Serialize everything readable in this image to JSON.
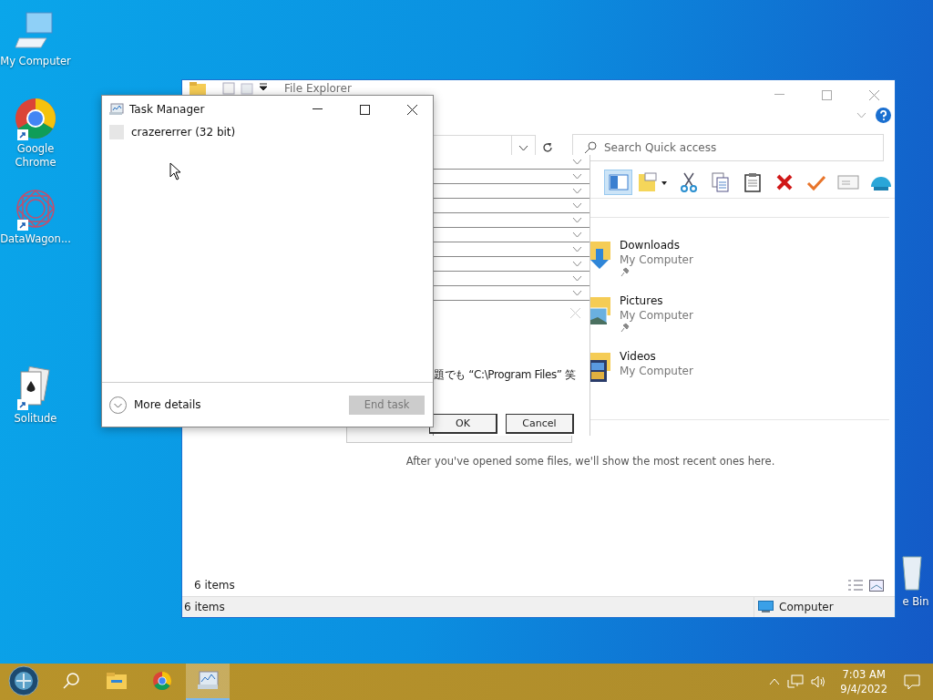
{
  "desktop_icons": [
    {
      "label": "My Computer",
      "kind": "computer",
      "shortcut": false
    },
    {
      "label": "Google Chrome",
      "kind": "chrome",
      "shortcut": true
    },
    {
      "label": "DataWagon...",
      "kind": "datawagon",
      "shortcut": true
    },
    {
      "label": "Solitude",
      "kind": "cards",
      "shortcut": true
    },
    {
      "label": "e Bin",
      "kind": "bin",
      "shortcut": false
    }
  ],
  "file_explorer": {
    "title": "File Explorer",
    "search": {
      "placeholder": "Search Quick access"
    },
    "toolbar": [
      {
        "kind": "pane",
        "selected": true
      },
      {
        "kind": "note",
        "selected": false
      },
      {
        "kind": "cut",
        "selected": false
      },
      {
        "kind": "copy",
        "selected": false
      },
      {
        "kind": "paste",
        "selected": false
      },
      {
        "kind": "delete",
        "selected": false
      },
      {
        "kind": "check",
        "selected": false
      },
      {
        "kind": "mail",
        "selected": false
      },
      {
        "kind": "shell",
        "selected": false
      }
    ],
    "items": [
      {
        "name": "Downloads",
        "location": "My Computer",
        "kind": "downloads",
        "pinned": true
      },
      {
        "name": "Pictures",
        "location": "My Computer",
        "kind": "pictures",
        "pinned": true
      },
      {
        "name": "Videos",
        "location": "My Computer",
        "kind": "videos",
        "pinned": false
      }
    ],
    "recent_message": "After you've opened some files, we'll show the most recent ones here.",
    "item_count": "6 items",
    "status_bar": {
      "items": "6 items",
      "location": "Computer"
    }
  },
  "broken_dialog": {
    "message": "題でも “C:\\Program Files” 笑",
    "buttons": [
      "OK",
      "Cancel"
    ]
  },
  "task_manager": {
    "title": "Task Manager",
    "apps": [
      {
        "name": "crazererrer (32 bit)"
      }
    ],
    "more_details": "More details",
    "end_task": {
      "label": "End task",
      "disabled": true
    }
  },
  "taskbar": {
    "apps": [
      {
        "kind": "start",
        "selected": false
      },
      {
        "kind": "search",
        "selected": false
      },
      {
        "kind": "explorer",
        "selected": false
      },
      {
        "kind": "chrome",
        "selected": false
      },
      {
        "kind": "taskmgr",
        "selected": true
      }
    ],
    "time": "7:03 AM",
    "date": "9/4/2022"
  }
}
